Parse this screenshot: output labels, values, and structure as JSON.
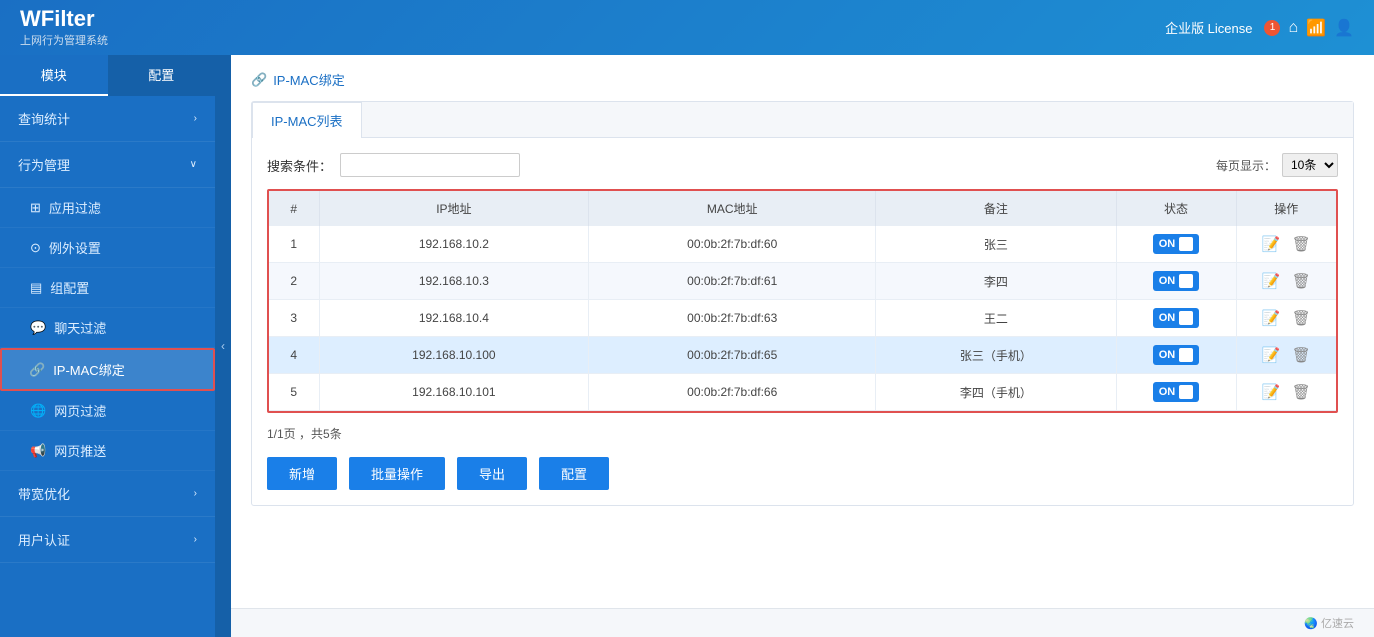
{
  "header": {
    "logo_title": "WFilter",
    "logo_sub": "上网行为管理系统",
    "license_text": "企业版 License",
    "notification_count": "1"
  },
  "sidebar": {
    "tab1": "模块",
    "tab2": "配置",
    "items": [
      {
        "id": "query-stats",
        "label": "查询统计",
        "hasArrow": true,
        "arrow": "›"
      },
      {
        "id": "behavior",
        "label": "行为管理",
        "hasArrow": true,
        "arrow": "∨",
        "expanded": true
      },
      {
        "id": "app-filter",
        "label": "应用过滤",
        "icon": "apps",
        "sub": true
      },
      {
        "id": "exception",
        "label": "例外设置",
        "icon": "except",
        "sub": true
      },
      {
        "id": "group-config",
        "label": "组配置",
        "icon": "group",
        "sub": true
      },
      {
        "id": "chat-filter",
        "label": "聊天过滤",
        "icon": "chat",
        "sub": true
      },
      {
        "id": "ip-mac",
        "label": "IP-MAC绑定",
        "icon": "mac",
        "sub": true,
        "selected": true
      },
      {
        "id": "web-filter",
        "label": "网页过滤",
        "icon": "web",
        "sub": true
      },
      {
        "id": "web-push",
        "label": "网页推送",
        "icon": "push",
        "sub": true
      },
      {
        "id": "bandwidth",
        "label": "带宽优化",
        "hasArrow": true,
        "arrow": "›"
      },
      {
        "id": "user-auth",
        "label": "用户认证",
        "hasArrow": true,
        "arrow": "›"
      }
    ]
  },
  "breadcrumb": {
    "text": "IP-MAC绑定"
  },
  "tab": {
    "label": "IP-MAC列表"
  },
  "search": {
    "label": "搜索条件：",
    "placeholder": "",
    "per_page_label": "每页显示：",
    "per_page_value": "10条"
  },
  "table": {
    "columns": [
      "#",
      "IP地址",
      "MAC地址",
      "备注",
      "状态",
      "操作"
    ],
    "rows": [
      {
        "id": 1,
        "ip": "192.168.10.2",
        "mac": "00:0b:2f:7b:df:60",
        "note": "张三",
        "status": "ON",
        "highlighted": false
      },
      {
        "id": 2,
        "ip": "192.168.10.3",
        "mac": "00:0b:2f:7b:df:61",
        "note": "李四",
        "status": "ON",
        "highlighted": false
      },
      {
        "id": 3,
        "ip": "192.168.10.4",
        "mac": "00:0b:2f:7b:df:63",
        "note": "王二",
        "status": "ON",
        "highlighted": false
      },
      {
        "id": 4,
        "ip": "192.168.10.100",
        "mac": "00:0b:2f:7b:df:65",
        "note": "张三（手机）",
        "status": "ON",
        "highlighted": true
      },
      {
        "id": 5,
        "ip": "192.168.10.101",
        "mac": "00:0b:2f:7b:df:66",
        "note": "李四（手机）",
        "status": "ON",
        "highlighted": false
      }
    ]
  },
  "pagination": {
    "text": "1/1页 ，共5条"
  },
  "buttons": {
    "add": "新增",
    "batch": "批量操作",
    "export": "导出",
    "config": "配置"
  },
  "footer": {
    "text": "@ 亿速云"
  }
}
